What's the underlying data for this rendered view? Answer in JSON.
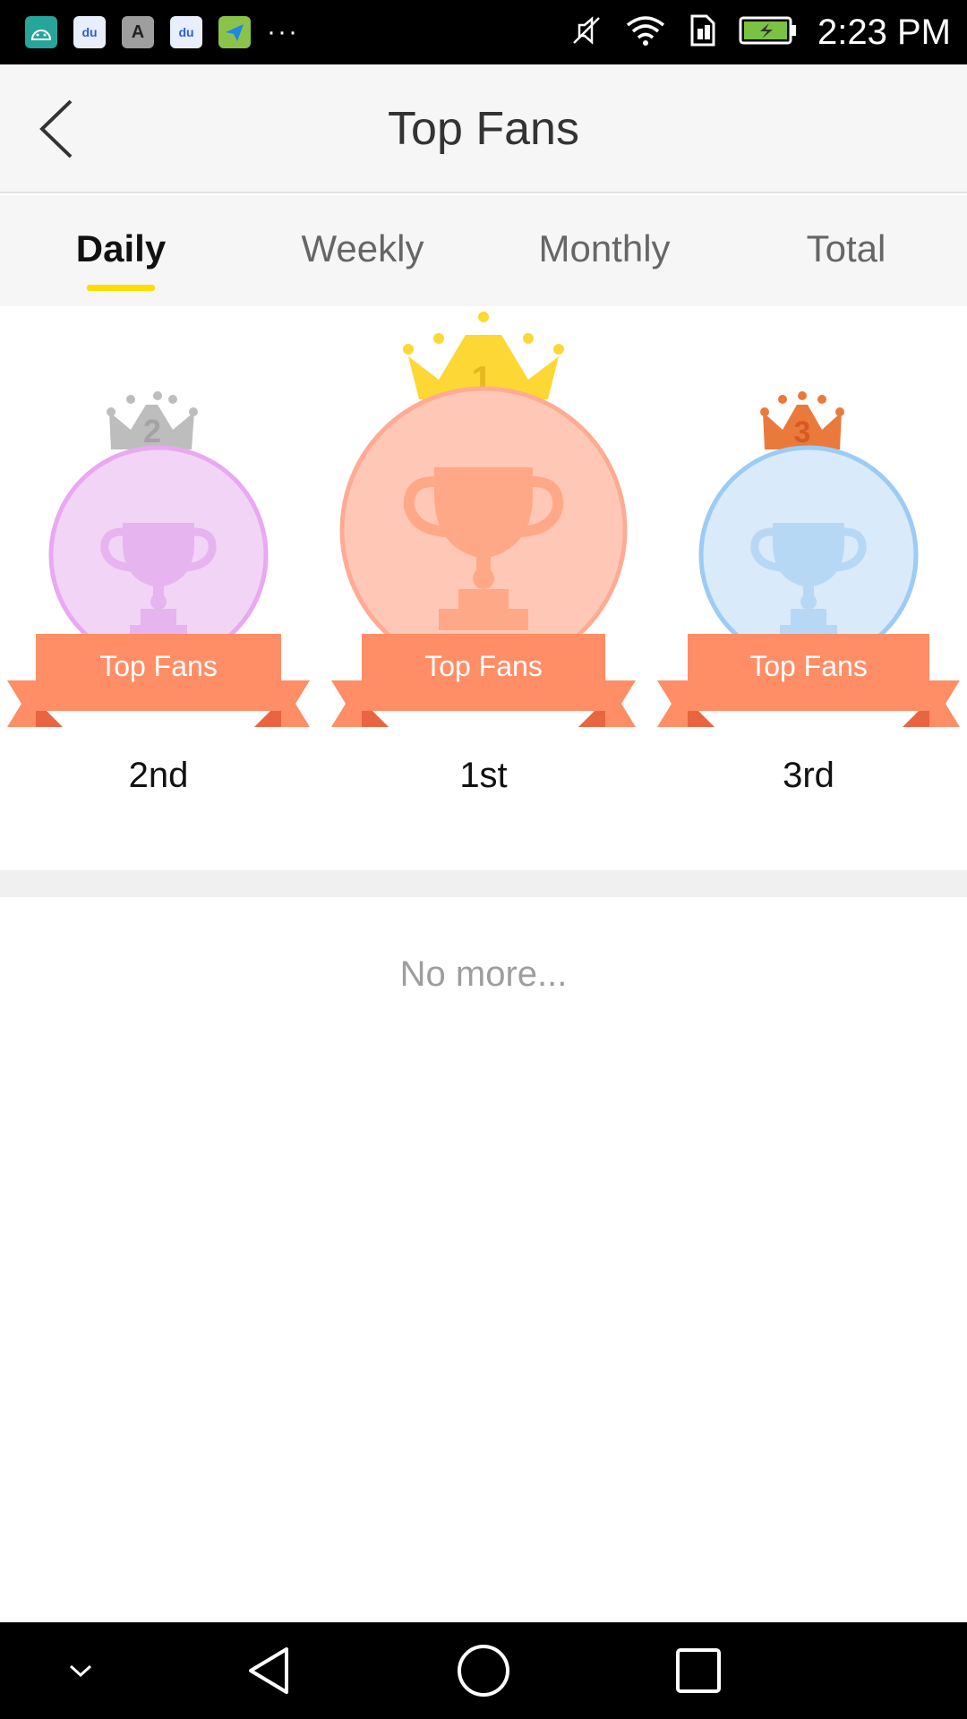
{
  "status_bar": {
    "time": "2:23 PM",
    "notification_icons": [
      "android-icon",
      "baidu-icon",
      "font-icon",
      "baidu-icon",
      "paper-plane-icon"
    ],
    "overflow": "···"
  },
  "header": {
    "title": "Top Fans",
    "back_icon": "chevron-left-icon"
  },
  "tabs": [
    {
      "label": "Daily",
      "active": true
    },
    {
      "label": "Weekly",
      "active": false
    },
    {
      "label": "Monthly",
      "active": false
    },
    {
      "label": "Total",
      "active": false
    }
  ],
  "podium": [
    {
      "rank_label": "2nd",
      "crown_number": "2",
      "ribbon_text": "Top Fans",
      "crown_color": "#bdbdbd",
      "circle_fill": "#f2d4f6",
      "circle_stroke": "#e8a8f2",
      "trophy_color": "#e6b4ee"
    },
    {
      "rank_label": "1st",
      "crown_number": "1",
      "ribbon_text": "Top Fans",
      "crown_color": "#fdd835",
      "circle_fill": "#ffc7b6",
      "circle_stroke": "#ffab94",
      "trophy_color": "#ffa888"
    },
    {
      "rank_label": "3rd",
      "crown_number": "3",
      "ribbon_text": "Top Fans",
      "crown_color": "#ea7a3c",
      "circle_fill": "#d9eafb",
      "circle_stroke": "#9ccbf6",
      "trophy_color": "#b7d8f4"
    }
  ],
  "colors": {
    "ribbon": "#ff8d66",
    "ribbon_dark": "#e8653f",
    "tab_indicator": "#ffdd00"
  },
  "list_footer": "No more..."
}
